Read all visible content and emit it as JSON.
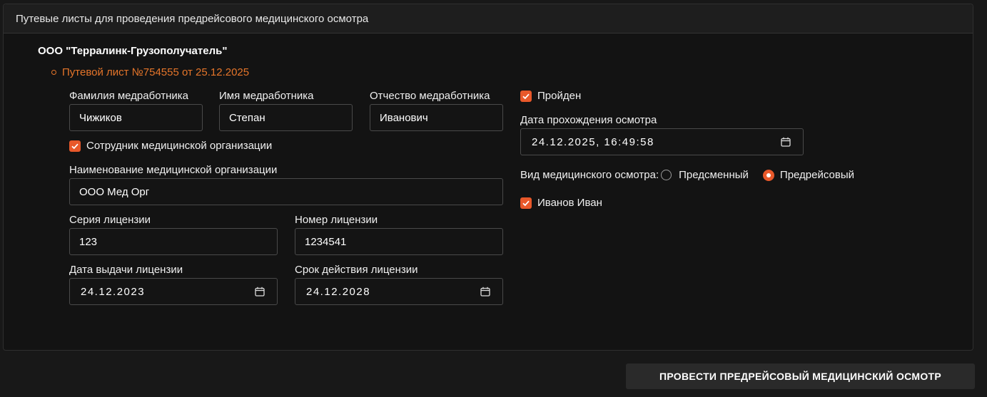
{
  "panel": {
    "title": "Путевые листы для проведения предрейсового медицинского осмотра"
  },
  "organization": {
    "name": "ООО \"Терралинк-Грузополучатель\"",
    "waybill": "Путевой лист №754555 от 25.12.2025"
  },
  "form": {
    "last_name_label": "Фамилия медработника",
    "last_name_value": "Чижиков",
    "first_name_label": "Имя медработника",
    "first_name_value": "Степан",
    "patronymic_label": "Отчество медработника",
    "patronymic_value": "Иванович",
    "med_employee_label": "Сотрудник медицинской организации",
    "med_employee_checked": true,
    "med_org_label": "Наименование медицинской организации",
    "med_org_value": "ООО Мед Орг",
    "license_series_label": "Серия лицензии",
    "license_series_value": "123",
    "license_number_label": "Номер лицензии",
    "license_number_value": "1234541",
    "license_issue_label": "Дата выдачи лицензии",
    "license_issue_value": "24.12.2023",
    "license_expiry_label": "Срок действия лицензии",
    "license_expiry_value": "24.12.2028"
  },
  "exam": {
    "passed_label": "Пройден",
    "passed_checked": true,
    "date_label": "Дата прохождения осмотра",
    "date_value": "24.12.2025, 16:49:58",
    "type_label": "Вид медицинского осмотра:",
    "type_options": [
      "Предсменный",
      "Предрейсовый"
    ],
    "type_selected": "Предрейсовый",
    "driver_label": "Иванов Иван",
    "driver_checked": true
  },
  "actions": {
    "submit_label": "ПРОВЕСТИ ПРЕДРЕЙСОВЫЙ МЕДИЦИНСКИЙ ОСМОТР"
  },
  "colors": {
    "accent": "#e8582a",
    "waybill_text": "#e5752a",
    "background": "#181818",
    "panel": "#131313"
  },
  "icons": [
    "calendar-icon",
    "checkmark-icon",
    "bullet-icon"
  ]
}
